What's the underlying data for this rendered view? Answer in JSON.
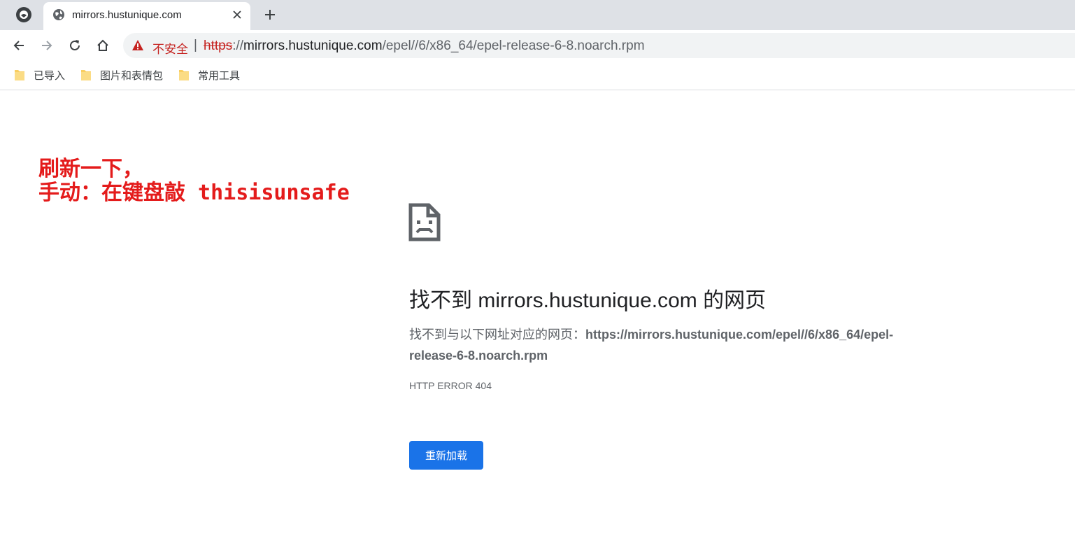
{
  "browser": {
    "tab": {
      "title": "mirrors.hustunique.com"
    },
    "omnibox": {
      "security_label": "不安全",
      "separator": "|",
      "url_scheme": "https",
      "url_sep": "://",
      "url_host": "mirrors.hustunique.com",
      "url_path": "/epel//6/x86_64/epel-release-6-8.noarch.rpm"
    },
    "bookmarks": [
      {
        "label": "已导入",
        "icon": "folder-icon"
      },
      {
        "label": "图片和表情包",
        "icon": "folder-icon"
      },
      {
        "label": "常用工具",
        "icon": "folder-icon"
      }
    ]
  },
  "annotation": {
    "line1": "刷新一下，",
    "line2": "手动：在键盘敲 thisisunsafe",
    "color": "#e41b1b"
  },
  "error_page": {
    "icon": "sad-page-icon",
    "title": "找不到 mirrors.hustunique.com 的网页",
    "desc_prefix": "找不到与以下网址对应的网页：",
    "desc_url": "https://mirrors.hustunique.com/epel//6/x86_64/epel-release-6-8.noarch.rpm",
    "error_code": "HTTP ERROR 404",
    "reload_label": "重新加载"
  },
  "colors": {
    "accent": "#1a73e8",
    "insecure": "#c5221f",
    "tabstrip": "#dee1e6"
  }
}
